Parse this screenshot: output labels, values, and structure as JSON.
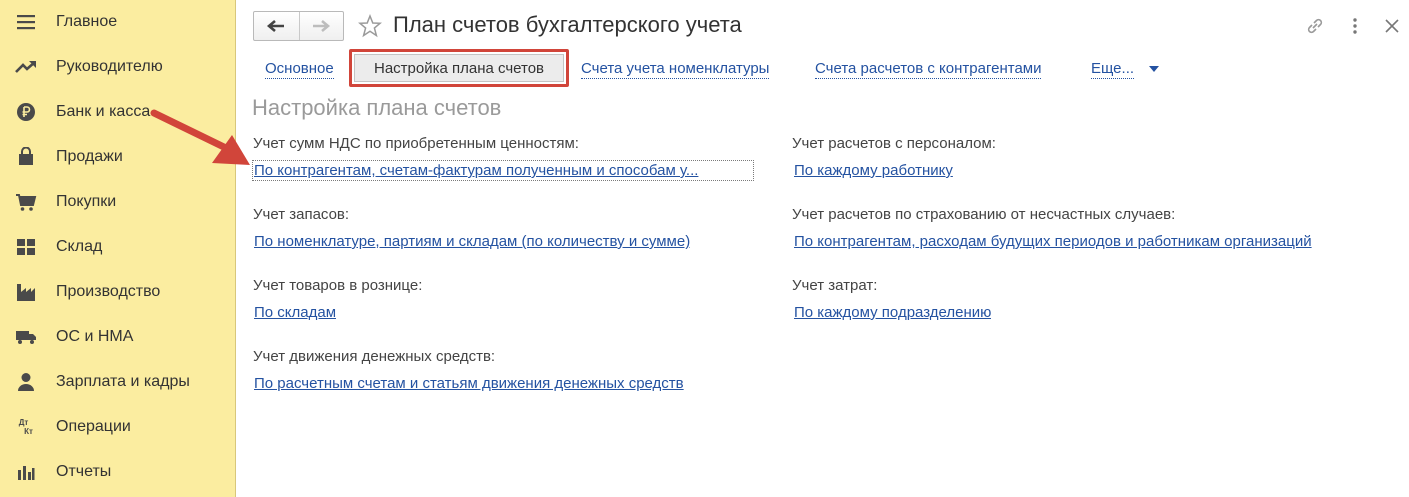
{
  "sidebar": {
    "items": [
      {
        "label": "Главное",
        "icon": "menu-icon"
      },
      {
        "label": "Руководителю",
        "icon": "trend-icon"
      },
      {
        "label": "Банк и касса",
        "icon": "ruble-icon"
      },
      {
        "label": "Продажи",
        "icon": "bag-icon"
      },
      {
        "label": "Покупки",
        "icon": "cart-icon"
      },
      {
        "label": "Склад",
        "icon": "warehouse-icon"
      },
      {
        "label": "Производство",
        "icon": "factory-icon"
      },
      {
        "label": "ОС и НМА",
        "icon": "truck-icon"
      },
      {
        "label": "Зарплата и кадры",
        "icon": "person-icon"
      },
      {
        "label": "Операции",
        "icon": "dt-kt-icon",
        "icon_text_top": "Дт",
        "icon_text_bottom": "Кт"
      },
      {
        "label": "Отчеты",
        "icon": "bar-chart-icon"
      }
    ]
  },
  "header": {
    "title": "План счетов бухгалтерского учета"
  },
  "tabs": [
    {
      "label": "Основное",
      "active": false
    },
    {
      "label": "Настройка плана счетов",
      "active": true
    },
    {
      "label": "Счета учета номенклатуры",
      "active": false
    },
    {
      "label": "Счета расчетов с контрагентами",
      "active": false
    },
    {
      "label": "Еще...",
      "active": false
    }
  ],
  "page_heading": "Настройка плана счетов",
  "fields_left": [
    {
      "label": "Учет сумм НДС по приобретенным ценностям:",
      "value": "По контрагентам, счетам-фактурам полученным и способам у..."
    },
    {
      "label": "Учет запасов:",
      "value": "По номенклатуре, партиям и складам (по количеству и сумме)"
    },
    {
      "label": "Учет товаров в рознице:",
      "value": "По складам"
    },
    {
      "label": "Учет движения денежных средств:",
      "value": "По расчетным счетам и статьям движения денежных средств"
    }
  ],
  "fields_right": [
    {
      "label": "Учет расчетов с персоналом:",
      "value": "По каждому работнику"
    },
    {
      "label": "Учет расчетов по страхованию от несчастных случаев:",
      "value": "По контрагентам, расходам будущих периодов и работникам организаций"
    },
    {
      "label": "Учет затрат:",
      "value": "По каждому подразделению"
    }
  ],
  "colors": {
    "sidebar_bg": "#fbeda0",
    "link": "#2452a1",
    "highlight": "#d1453a"
  }
}
